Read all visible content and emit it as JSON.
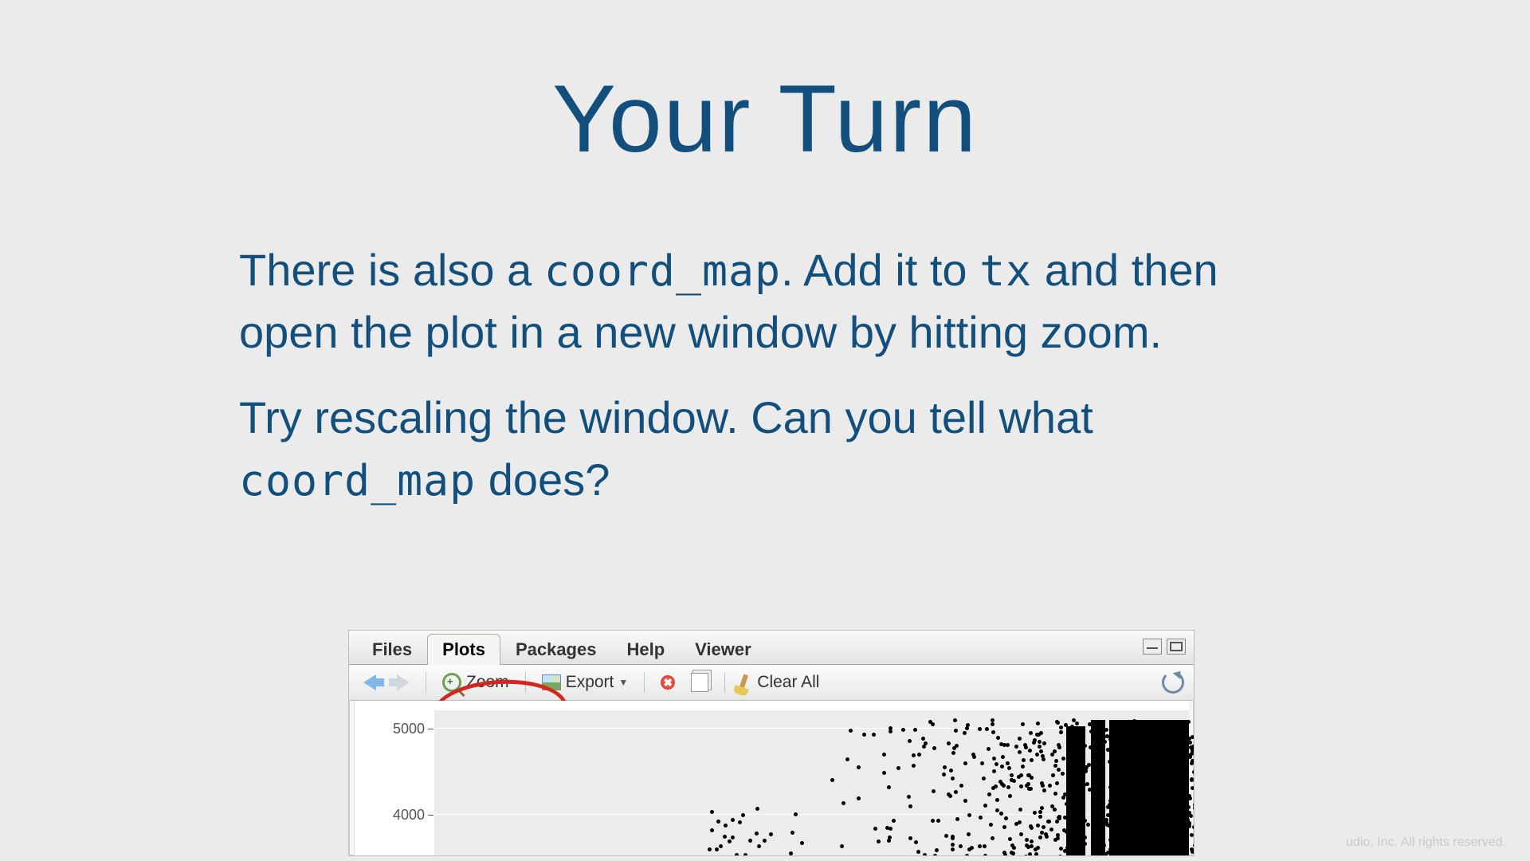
{
  "title": "Your Turn",
  "paragraph1": {
    "pre": "There is also a ",
    "code1": "coord_map",
    "mid": ". Add it to ",
    "code2": "tx",
    "post": " and then open the plot in a new window by hitting zoom."
  },
  "paragraph2": {
    "pre": "Try rescaling the window. Can you tell what ",
    "code1": "coord_map",
    "post": " does?"
  },
  "tabs": {
    "files": "Files",
    "plots": "Plots",
    "packages": "Packages",
    "help": "Help",
    "viewer": "Viewer"
  },
  "toolbar": {
    "zoom": "Zoom",
    "export": "Export",
    "clear_all": "Clear All"
  },
  "axis": {
    "y5000": "5000",
    "y4000": "4000"
  },
  "footer": "udio, Inc. All rights reserved."
}
